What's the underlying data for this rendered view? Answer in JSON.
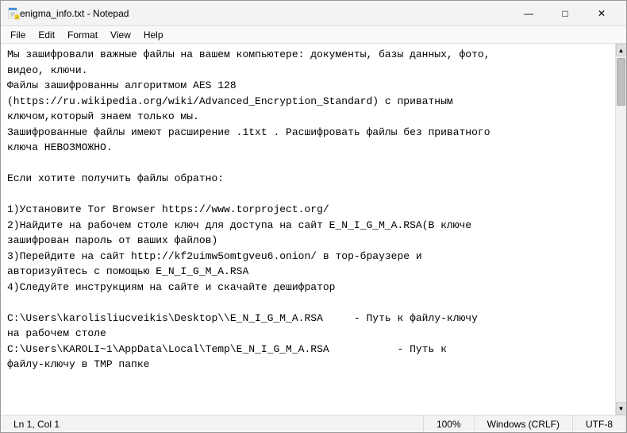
{
  "window": {
    "title": "enigma_info.txt - Notepad",
    "icon": "notepad"
  },
  "titlebar": {
    "minimize_label": "—",
    "maximize_label": "□",
    "close_label": "✕"
  },
  "menubar": {
    "items": [
      {
        "label": "File",
        "id": "file"
      },
      {
        "label": "Edit",
        "id": "edit"
      },
      {
        "label": "Format",
        "id": "format"
      },
      {
        "label": "View",
        "id": "view"
      },
      {
        "label": "Help",
        "id": "help"
      }
    ]
  },
  "content": {
    "text": "Мы зашифровали важные файлы на вашем компьютере: документы, базы данных, фото,\nвидео, ключи.\nФайлы зашифрованны алгоритмом AES 128\n(https://ru.wikipedia.org/wiki/Advanced_Encryption_Standard) с приватным\nключом,который знаем только мы.\nЗашифрованные файлы имеют расширение .1txt . Расшифровать файлы без приватного\nключа НЕВОЗМОЖНО.\n\nЕсли хотите получить файлы обратно:\n\n1)Установите Tor Browser https://www.torproject.org/\n2)Найдите на рабочем столе ключ для доступа на сайт E_N_I_G_M_A.RSA(В ключе\nзашифрован пароль от ваших файлов)\n3)Перейдите на сайт http://kf2uimw5omtgveu6.onion/ в тор-браузере и\nавторизуйтесь с помощью E_N_I_G_M_A.RSA\n4)Следуйте инструкциям на сайте и скачайте дешифратор\n\nC:\\Users\\karolisliucveikis\\Desktop\\\\E_N_I_G_M_A.RSA     - Путь к файлу-ключу\nна рабочем столе\nC:\\Users\\KAROLI~1\\AppData\\Local\\Temp\\E_N_I_G_M_A.RSA           - Путь к\nфайлу-ключу в TMP папке"
  },
  "statusbar": {
    "position": "Ln 1, Col 1",
    "zoom": "100%",
    "line_ending": "Windows (CRLF)",
    "encoding": "UTF-8"
  }
}
